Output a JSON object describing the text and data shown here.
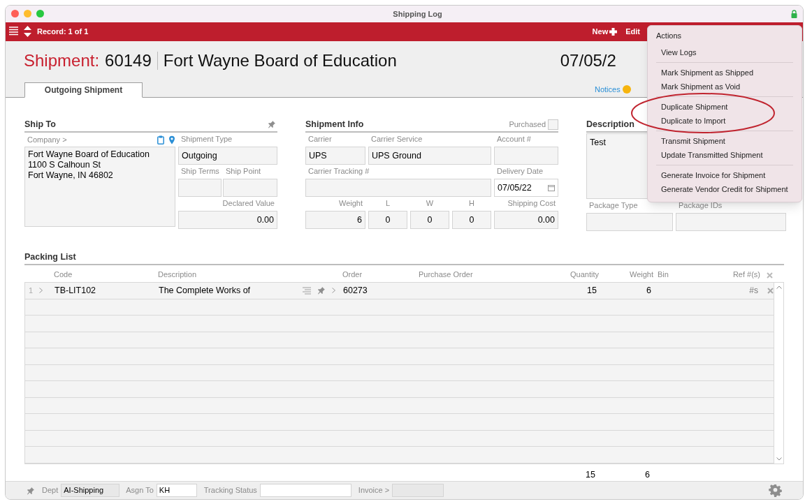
{
  "window": {
    "title": "Shipping Log"
  },
  "toolbar": {
    "record": "Record: 1 of 1",
    "new": "New",
    "edit": "Edit"
  },
  "header": {
    "label": "Shipment:",
    "number": "60149",
    "company": "Fort Wayne Board of Education",
    "date": "07/05/2"
  },
  "tabs": [
    {
      "label": "Outgoing Shipment",
      "selected": true
    }
  ],
  "notices": "Notices",
  "ship_to": {
    "title": "Ship To",
    "company_label": "Company >",
    "address": [
      "Fort Wayne Board of Education",
      "1100 S Calhoun St",
      "Fort Wayne, IN 46802"
    ],
    "shipment_type": {
      "label": "Shipment Type",
      "value": "Outgoing"
    },
    "ship_terms": {
      "label": "Ship Terms"
    },
    "ship_point": {
      "label": "Ship Point"
    },
    "declared_value": {
      "label": "Declared Value",
      "value": "0.00"
    }
  },
  "shipment_info": {
    "title": "Shipment Info",
    "purchased": {
      "label": "Purchased",
      "checked": false
    },
    "carrier": {
      "label": "Carrier",
      "value": "UPS"
    },
    "carrier_service": {
      "label": "Carrier Service",
      "value": "UPS Ground"
    },
    "account": {
      "label": "Account #"
    },
    "tracking": {
      "label": "Carrier Tracking #"
    },
    "delivery_date": {
      "label": "Delivery Date",
      "value": "07/05/22"
    },
    "weight": {
      "label": "Weight",
      "value": "6"
    },
    "l": {
      "label": "L",
      "value": "0"
    },
    "w": {
      "label": "W",
      "value": "0"
    },
    "h": {
      "label": "H",
      "value": "0"
    },
    "shipping_cost": {
      "label": "Shipping Cost",
      "value": "0.00"
    }
  },
  "description": {
    "title": "Description",
    "value": "Test",
    "package_type": {
      "label": "Package Type"
    },
    "package_ids": {
      "label": "Package IDs"
    }
  },
  "packing_list": {
    "title": "Packing List",
    "columns": [
      "Code",
      "Description",
      "Order",
      "Purchase Order",
      "Quantity",
      "Weight",
      "Bin",
      "Ref #(s)"
    ],
    "rows": [
      {
        "number": "1",
        "code": "TB-LIT102",
        "description": "The Complete Works of",
        "order": "60273",
        "quantity": "15",
        "weight": "6",
        "ref": "#s"
      }
    ],
    "totals": {
      "quantity": "15",
      "weight": "6"
    }
  },
  "footer": {
    "dept": {
      "label": "Dept",
      "value": "AI-Shipping"
    },
    "assign": {
      "label": "Asgn To",
      "value": "KH"
    },
    "tracking_status": {
      "label": "Tracking Status"
    },
    "invoice": {
      "label": "Invoice >"
    }
  },
  "actions_menu": {
    "title": "Actions",
    "groups": [
      [
        "View Logs"
      ],
      [
        "Mark Shipment as Shipped",
        "Mark Shipment as Void"
      ],
      [
        "Duplicate Shipment",
        "Duplicate to Import"
      ],
      [
        "Transmit Shipment",
        "Update Transmitted Shipment"
      ],
      [
        "Generate Invoice for Shipment",
        "Generate Vendor Credit for Shipment"
      ]
    ]
  }
}
